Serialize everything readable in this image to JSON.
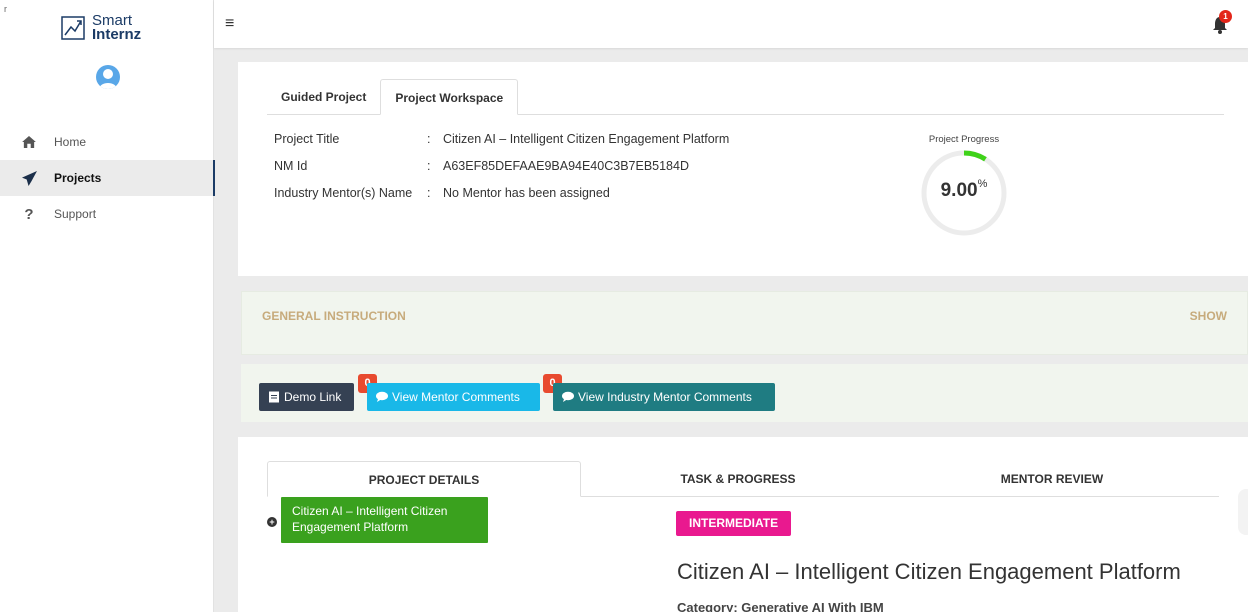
{
  "brand": {
    "line1": "Smart",
    "line2": "Internz",
    "corner_mark": "r"
  },
  "sidebar": {
    "items": [
      {
        "label": "Home",
        "icon": "home-icon",
        "active": false
      },
      {
        "label": "Projects",
        "icon": "paper-plane-icon",
        "active": true
      },
      {
        "label": "Support",
        "icon": "question-mark-icon",
        "active": false
      }
    ]
  },
  "topbar": {
    "notification_count": "1"
  },
  "project": {
    "tabs": [
      {
        "label": "Guided Project",
        "active": false
      },
      {
        "label": "Project Workspace",
        "active": true
      }
    ],
    "info": [
      {
        "label": "Project Title",
        "sep": ":",
        "value": "Citizen AI – Intelligent Citizen Engagement Platform"
      },
      {
        "label": "NM Id",
        "sep": ":",
        "value": "A63EF85DEFAAE9BA94E40C3B7EB5184D"
      },
      {
        "label": "Industry Mentor(s) Name",
        "sep": ":",
        "value": "No Mentor has been assigned"
      }
    ],
    "progress": {
      "title": "Project Progress",
      "value": "9.00",
      "unit": "%",
      "fraction": 0.09,
      "color": "#3fd219",
      "track_color": "#ececec"
    }
  },
  "general_instruction": {
    "title": "GENERAL INSTRUCTION",
    "action": "SHOW"
  },
  "actions": {
    "demo_link": "Demo Link",
    "view_mentor_comments": "View Mentor Comments",
    "mentor_comment_count": "0",
    "view_industry_mentor_comments": "View Industry Mentor Comments",
    "industry_comment_count": "0"
  },
  "details": {
    "tabs": [
      {
        "label": "PROJECT DETAILS",
        "active": true
      },
      {
        "label": "TASK & PROGRESS",
        "active": false
      },
      {
        "label": "MENTOR REVIEW",
        "active": false
      }
    ],
    "tree_node": "Citizen AI – Intelligent Citizen Engagement Platform",
    "tree_toggle": "+",
    "level": "INTERMEDIATE",
    "title": "Citizen AI – Intelligent Citizen Engagement Platform",
    "category": "Category: Generative AI With IBM"
  },
  "colors": {
    "brand_navy": "#1b3b66",
    "demo_button": "#354153",
    "mentor_button": "#19b8e8",
    "industry_button": "#1f7c82",
    "badge_red": "#e84a2f",
    "level_pink": "#e9198f",
    "tree_green": "#3aa11e",
    "instruction_text": "#c7ab7c"
  }
}
